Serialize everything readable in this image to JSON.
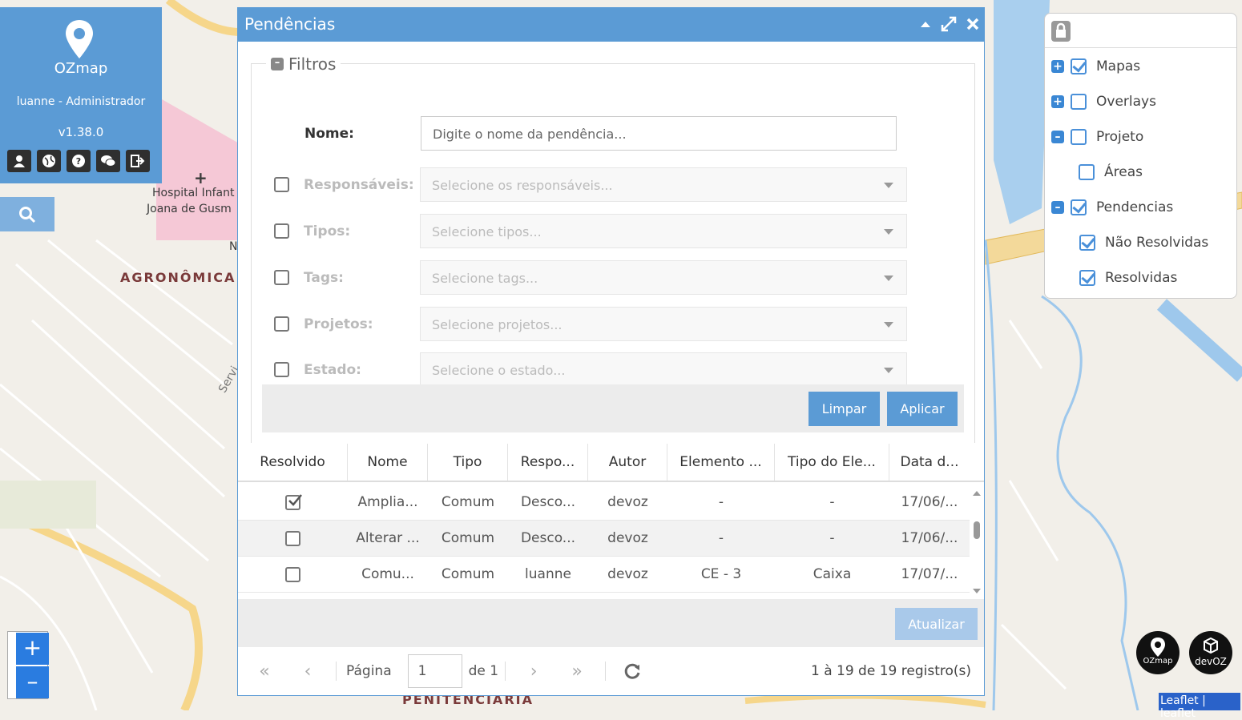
{
  "brand": {
    "logo_text_a": "OZ",
    "logo_text_b": "map",
    "user": "luanne - Administrador",
    "version": "v1.38.0",
    "tools": [
      "user-icon",
      "globe-icon",
      "help-icon",
      "chat-icon",
      "logout-icon"
    ]
  },
  "map": {
    "labels": {
      "hospital_1": "Hospital Infant",
      "hospital_2": "Joana de Gusm",
      "district": "AGRONÔMICA",
      "n": "N",
      "serv": "Servi",
      "penit": "PENITENCIÁRIA"
    }
  },
  "zoom": {
    "in": "+",
    "out": "–"
  },
  "dialog": {
    "title": "Pendências",
    "filters": {
      "legend": "Filtros",
      "nome_label": "Nome:",
      "nome_placeholder": "Digite o nome da pendência...",
      "rows": [
        {
          "label": "Responsáveis:",
          "placeholder": "Selecione os responsáveis..."
        },
        {
          "label": "Tipos:",
          "placeholder": "Selecione tipos..."
        },
        {
          "label": "Tags:",
          "placeholder": "Selecione tags..."
        },
        {
          "label": "Projetos:",
          "placeholder": "Selecione projetos..."
        },
        {
          "label": "Estado:",
          "placeholder": "Selecione o estado..."
        }
      ],
      "clear_label": "Limpar",
      "apply_label": "Aplicar"
    },
    "table": {
      "columns": [
        "Resolvido",
        "Nome",
        "Tipo",
        "Respo...",
        "Autor",
        "Elemento ...",
        "Tipo do Ele...",
        "Data d..."
      ],
      "rows": [
        {
          "resolved": true,
          "nome": "Amplia...",
          "tipo": "Comum",
          "resp": "Desco...",
          "autor": "devoz",
          "elemento": "-",
          "tipo_el": "-",
          "data": "17/06/..."
        },
        {
          "resolved": false,
          "nome": "Alterar ...",
          "tipo": "Comum",
          "resp": "Desco...",
          "autor": "devoz",
          "elemento": "-",
          "tipo_el": "-",
          "data": "17/06/..."
        },
        {
          "resolved": false,
          "nome": "Comu...",
          "tipo": "Comum",
          "resp": "luanne",
          "autor": "devoz",
          "elemento": "CE - 3",
          "tipo_el": "Caixa",
          "data": "17/07/..."
        }
      ]
    },
    "update_label": "Atualizar",
    "pager": {
      "page_label": "Página",
      "page_value": "1",
      "of_label": "de 1",
      "summary": "1 à 19 de 19 registro(s)"
    }
  },
  "layers": {
    "items": [
      {
        "label": "Mapas",
        "checked": true,
        "toggle": "+"
      },
      {
        "label": "Overlays",
        "checked": false,
        "toggle": "+"
      },
      {
        "label": "Projeto",
        "checked": false,
        "toggle": "–"
      },
      {
        "label": "Áreas",
        "checked": false,
        "toggle": ""
      },
      {
        "label": "Pendencias",
        "checked": true,
        "toggle": "–"
      },
      {
        "label": "Não Resolvidas",
        "checked": true,
        "toggle": ""
      },
      {
        "label": "Resolvidas",
        "checked": true,
        "toggle": ""
      }
    ]
  },
  "corner_logos": {
    "ozmap": "OZmap",
    "devoz": "devOZ"
  },
  "attribution": "Leaflet | leaflet"
}
